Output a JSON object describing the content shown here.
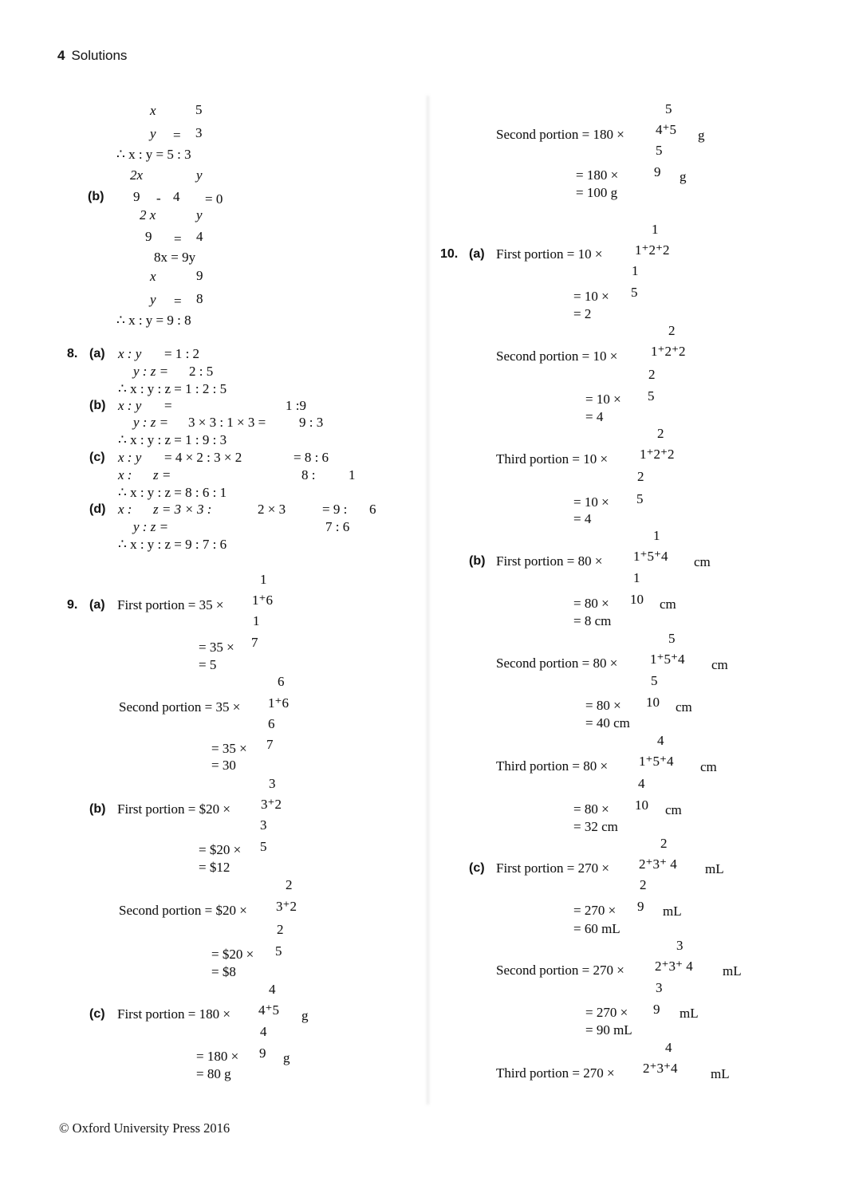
{
  "page": {
    "number": "4",
    "title": "Solutions",
    "footer": "© Oxford University Press 2016"
  },
  "left_column": {
    "q7b_continued": {
      "lines": [
        {
          "frac_num": "x",
          "frac_den": "y",
          "eq": "=",
          "val_num": "5",
          "val_den": "3"
        },
        {
          "text": "∴   x : y = 5 : 3"
        }
      ],
      "label": "(b)",
      "eqn1_num_left": "2x",
      "eqn1_den_left": "9",
      "minus": "-",
      "eqn1_num_right": "y",
      "eqn1_den_right": "4",
      "eqn1_tail": "= 0",
      "eqn2_num_left": "2 x",
      "eqn2_den_left": "9",
      "eqn2_eq": "=",
      "eqn2_num_right": "y",
      "eqn2_den_right": "4",
      "eqn3": "8x = 9y",
      "eqn4_num_left": "x",
      "eqn4_den_left": "y",
      "eqn4_eq": "=",
      "eqn4_num_right": "9",
      "eqn4_den_right": "8",
      "conclusion": "∴   x : y = 9 : 8"
    },
    "q8": {
      "number": "8.",
      "parts": [
        {
          "label": "(a)",
          "rows": [
            {
              "lhs": "x : y",
              "rhs": "= 1 : 2"
            },
            {
              "lhs": "y : z =",
              "rhs": "2 : 5"
            },
            {
              "lhs": "∴   x : y : z = 1 : 2 : 5",
              "rhs": ""
            }
          ]
        },
        {
          "label": "(b)",
          "rows": [
            {
              "lhs": "x : y",
              "mid": "=",
              "rhs": "1 :9"
            },
            {
              "lhs": "y : z =",
              "mid": "3 × 3 : 1 × 3 =",
              "rhs": "9 : 3"
            },
            {
              "lhs": "∴   x : y : z = 1 : 9 : 3",
              "rhs": ""
            }
          ]
        },
        {
          "label": "(c)",
          "rows": [
            {
              "lhs": "x : y",
              "mid": "= 4 × 2 : 3 × 2",
              "rhs": "= 8 : 6"
            },
            {
              "lhs": "x :",
              "mid": "z =",
              "rhs": "8 :",
              "rhs2": "1"
            },
            {
              "lhs": "∴   x : y : z = 8 : 6 : 1",
              "rhs": ""
            }
          ]
        },
        {
          "label": "(d)",
          "rows": [
            {
              "lhs": "x :",
              "mid": "z = 3 × 3 :",
              "mid2": "2 × 3",
              "rhs": "= 9 :",
              "rhs2": "6"
            },
            {
              "lhs": "y : z =",
              "rhs": "7 : 6"
            },
            {
              "lhs": "∴   x : y : z = 9 : 7 : 6",
              "rhs": ""
            }
          ]
        }
      ]
    },
    "q9": {
      "number": "9.",
      "parts": [
        {
          "label": "(a)",
          "steps": [
            {
              "lead": "First portion = 35 ×",
              "num": "1",
              "den": "1⁺6",
              "unit": ""
            },
            {
              "lead": "= 35 ×",
              "num": "1",
              "den": "7",
              "unit": ""
            },
            {
              "lead": "= 5",
              "num": "",
              "den": "",
              "unit": ""
            },
            {
              "lead": "Second portion = 35 ×",
              "num": "6",
              "den": "1⁺6",
              "unit": ""
            },
            {
              "lead": "= 35 ×",
              "num": "6",
              "den": "7",
              "unit": ""
            },
            {
              "lead": "= 30",
              "num": "",
              "den": "",
              "unit": ""
            }
          ]
        },
        {
          "label": "(b)",
          "steps": [
            {
              "lead": "First portion = $20 ×",
              "num": "3",
              "den": "3⁺2",
              "unit": ""
            },
            {
              "lead": "= $20 ×",
              "num": "3",
              "den": "5",
              "unit": ""
            },
            {
              "lead": "= $12",
              "num": "",
              "den": "",
              "unit": ""
            },
            {
              "lead": "Second portion = $20 ×",
              "num": "2",
              "den": "3⁺2",
              "unit": ""
            },
            {
              "lead": "= $20 ×",
              "num": "2",
              "den": "5",
              "unit": ""
            },
            {
              "lead": "= $8",
              "num": "",
              "den": "",
              "unit": ""
            }
          ]
        },
        {
          "label": "(c)",
          "steps": [
            {
              "lead": "First portion = 180 ×",
              "num": "4",
              "den": "4⁺5",
              "unit": "g"
            },
            {
              "lead": "= 180 ×",
              "num": "4",
              "den": "9",
              "unit": "g"
            },
            {
              "lead": "= 80 g",
              "num": "",
              "den": "",
              "unit": ""
            }
          ]
        }
      ]
    }
  },
  "right_column": {
    "q9c_continued": {
      "steps": [
        {
          "lead": "Second portion = 180 ×",
          "num": "5",
          "den": "4⁺5",
          "unit": "g"
        },
        {
          "lead": "= 180 ×",
          "num": "5",
          "den": "9",
          "unit": "g"
        },
        {
          "lead": "= 100 g",
          "num": "",
          "den": "",
          "unit": ""
        }
      ]
    },
    "q10": {
      "number": "10.",
      "parts": [
        {
          "label": "(a)",
          "steps": [
            {
              "lead": "First portion = 10 ×",
              "num": "1",
              "den": "1⁺2⁺2",
              "unit": ""
            },
            {
              "lead": "= 10 ×",
              "num": "1",
              "den": "5",
              "unit": ""
            },
            {
              "lead": "= 2",
              "num": "",
              "den": "",
              "unit": ""
            },
            {
              "lead": "Second portion = 10 ×",
              "num": "2",
              "den": "1⁺2⁺2",
              "unit": ""
            },
            {
              "lead": "= 10 ×",
              "num": "2",
              "den": "5",
              "unit": ""
            },
            {
              "lead": "= 4",
              "num": "",
              "den": "",
              "unit": ""
            },
            {
              "lead": "Third portion = 10 ×",
              "num": "2",
              "den": "1⁺2⁺2",
              "unit": ""
            },
            {
              "lead": "= 10 ×",
              "num": "2",
              "den": "5",
              "unit": ""
            },
            {
              "lead": "= 4",
              "num": "",
              "den": "",
              "unit": ""
            }
          ]
        },
        {
          "label": "(b)",
          "steps": [
            {
              "lead": "First portion = 80 ×",
              "num": "1",
              "den": "1⁺5⁺4",
              "unit": "cm"
            },
            {
              "lead": "= 80 ×",
              "num": "1",
              "den": "10",
              "unit": "cm"
            },
            {
              "lead": "= 8 cm",
              "num": "",
              "den": "",
              "unit": ""
            },
            {
              "lead": "Second portion = 80 ×",
              "num": "5",
              "den": "1⁺5⁺4",
              "unit": "cm"
            },
            {
              "lead": "= 80 ×",
              "num": "5",
              "den": "10",
              "unit": "cm"
            },
            {
              "lead": "= 40 cm",
              "num": "",
              "den": "",
              "unit": ""
            },
            {
              "lead": "Third portion = 80 ×",
              "num": "4",
              "den": "1⁺5⁺4",
              "unit": "cm"
            },
            {
              "lead": "= 80 ×",
              "num": "4",
              "den": "10",
              "unit": "cm"
            },
            {
              "lead": "= 32 cm",
              "num": "",
              "den": "",
              "unit": ""
            }
          ]
        },
        {
          "label": "(c)",
          "steps": [
            {
              "lead": "First portion = 270 ×",
              "num": "2",
              "den": "2⁺3⁺ 4",
              "unit": "mL"
            },
            {
              "lead": "= 270 ×",
              "num": "2",
              "den": "9",
              "unit": "mL"
            },
            {
              "lead": "= 60 mL",
              "num": "",
              "den": "",
              "unit": ""
            },
            {
              "lead": "Second portion = 270 ×",
              "num": "3",
              "den": "2⁺3⁺ 4",
              "unit": "mL"
            },
            {
              "lead": "= 270 ×",
              "num": "3",
              "den": "9",
              "unit": "mL"
            },
            {
              "lead": "= 90 mL",
              "num": "",
              "den": "",
              "unit": ""
            },
            {
              "lead": "Third portion = 270 ×",
              "num": "4",
              "den": "2⁺3⁺4",
              "unit": "mL"
            }
          ]
        }
      ]
    }
  }
}
